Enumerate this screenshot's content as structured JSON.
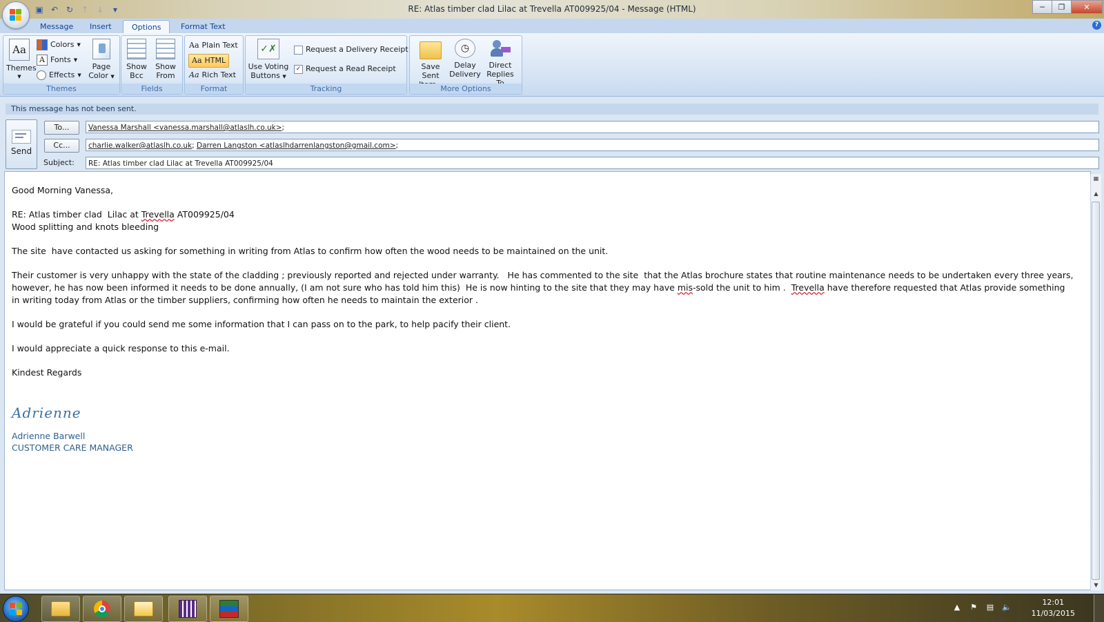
{
  "window": {
    "title": "RE: Atlas timber clad  Lilac at Trevella AT009925/04 - Message (HTML)",
    "controls": [
      "minimize",
      "restore",
      "close"
    ]
  },
  "quick_access": [
    "save-icon",
    "undo-icon",
    "redo-icon",
    "previous-icon",
    "next-icon",
    "customize-icon"
  ],
  "ribbon": {
    "tabs": [
      "Message",
      "Insert",
      "Options",
      "Format Text"
    ],
    "active_tab": "Options",
    "groups": {
      "themes": {
        "label": "Themes",
        "themes_btn": "Themes",
        "colors": "Colors",
        "fonts": "Fonts",
        "effects": "Effects",
        "page_color_1": "Page",
        "page_color_2": "Color"
      },
      "fields": {
        "label": "Fields",
        "show_bcc_1": "Show",
        "show_bcc_2": "Bcc",
        "show_from_1": "Show",
        "show_from_2": "From"
      },
      "format": {
        "label": "Format",
        "plain_text": "Plain Text",
        "html": "HTML",
        "rich_text": "Rich Text",
        "selected": "HTML"
      },
      "tracking": {
        "label": "Tracking",
        "voting_1": "Use Voting",
        "voting_2": "Buttons",
        "delivery_receipt": "Request a Delivery Receipt",
        "delivery_receipt_checked": false,
        "read_receipt": "Request a Read Receipt",
        "read_receipt_checked": true
      },
      "more_options": {
        "label": "More Options",
        "save_sent_1": "Save Sent",
        "save_sent_2": "Item",
        "delay_1": "Delay",
        "delay_2": "Delivery",
        "direct_1": "Direct",
        "direct_2": "Replies To"
      }
    }
  },
  "info_bar": "This message has not been sent.",
  "compose": {
    "send_label": "Send",
    "to_button": "To...",
    "cc_button": "Cc...",
    "subject_label": "Subject:",
    "to": {
      "addr1": "Vanessa Marshall <vanessa.marshall@atlaslh.co.uk>",
      "sep": ";"
    },
    "cc": {
      "addr1": "charlie.walker@atlaslh.co.uk",
      "sep1": "; ",
      "addr2": "Darren Langston <atlaslhdarrenlangston@gmail.com>",
      "sep2": ";"
    },
    "subject": "RE: Atlas timber clad  Lilac at Trevella AT009925/04"
  },
  "body": {
    "greeting": "Good Morning Vanessa,",
    "re_prefix": "RE: Atlas timber clad  Lilac at ",
    "re_trevella": "Trevella",
    "re_suffix": " AT009925/04",
    "re_line2": "Wood splitting and knots bleeding",
    "para1": "The site  have contacted us asking for something in writing from Atlas to confirm how often the wood needs to be maintained on the unit.",
    "para2_a": "Their customer is very unhappy with the state of the cladding ; previously reported and rejected under warranty.   He has commented to the site  that the Atlas brochure states that routine maintenance needs to be undertaken every three years, however, he has now been informed it needs to be done annually, (I am not sure who has told him this)  He is now hinting to the site that they may have ",
    "para2_mis": "mis",
    "para2_b": "-sold the unit to him .  ",
    "para2_trevella": "Trevella",
    "para2_c": " have therefore requested that Atlas provide something in writing today from Atlas or the timber suppliers, confirming how often he needs to maintain the exterior .",
    "para3": "I would be grateful if you could send me some information that I can pass on to the park, to help pacify their client.",
    "para4": "I would appreciate a quick response to this e-mail.",
    "closing": "Kindest Regards",
    "signature_script": "Adrienne",
    "sig_name": "Adrienne Barwell",
    "sig_title": "CUSTOMER CARE MANAGER"
  },
  "taskbar": {
    "pinned": [
      "file-explorer-icon",
      "chrome-icon",
      "outlook-icon",
      "calendar-app-icon",
      "sage-icon"
    ],
    "time": "12:01",
    "date": "11/03/2015"
  },
  "colors": {
    "ribbon_bg": "#dbe6f4",
    "tab_text": "#15428b",
    "signature": "#2f5f8f",
    "html_highlight": "#ffc95a"
  }
}
